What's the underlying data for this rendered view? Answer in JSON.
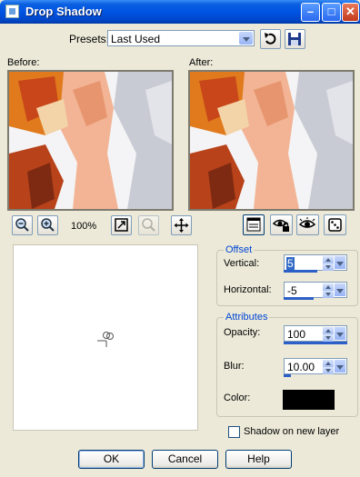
{
  "window": {
    "title": "Drop Shadow",
    "min_symbol": "–",
    "max_symbol": "□",
    "close_symbol": "✕"
  },
  "presets": {
    "label": "Presets:",
    "value": "Last Used"
  },
  "preview": {
    "before_label": "Before:",
    "after_label": "After:",
    "zoom": "100%"
  },
  "offset": {
    "group_label": "Offset",
    "vertical_label": "Vertical:",
    "vertical_value": "5",
    "horizontal_label": "Horizontal:",
    "horizontal_value": "-5"
  },
  "attributes": {
    "group_label": "Attributes",
    "opacity_label": "Opacity:",
    "opacity_value": "100",
    "blur_label": "Blur:",
    "blur_value": "10.00",
    "color_label": "Color:",
    "color_value": "#000000"
  },
  "shadow_new_layer": {
    "label": "Shadow on new layer",
    "checked": false
  },
  "buttons": {
    "ok": "OK",
    "cancel": "Cancel",
    "help": "Help"
  }
}
